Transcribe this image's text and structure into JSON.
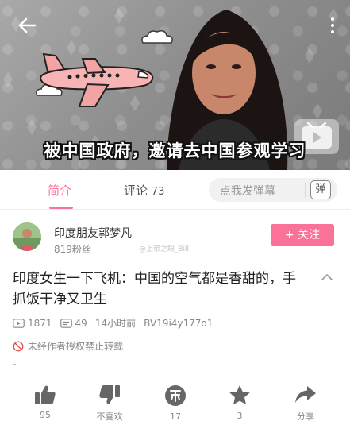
{
  "video": {
    "caption": "被中国政府，邀请去中国参观学习"
  },
  "tabs": {
    "intro_label": "简介",
    "comments_label": "评论",
    "comments_count": "73"
  },
  "danmaku": {
    "placeholder": "点我发弹幕",
    "toggle_label": "弹"
  },
  "uploader": {
    "name": "印度朋友郭梦凡",
    "fans": "819粉丝",
    "watermark": "@上帝之眼_Bill",
    "follow_label": "+ 关注"
  },
  "info": {
    "title": "印度女生一下飞机：中国的空气都是香甜的，手抓饭干净又卫生",
    "views": "1871",
    "danmaku_count": "49",
    "time": "14小时前",
    "bvid": "BV19i4y177o1",
    "copyright_notice": "未经作者授权禁止转载"
  },
  "actions": {
    "like_count": "95",
    "dislike_label": "不喜欢",
    "coin_count": "17",
    "favorite_count": "3",
    "share_label": "分享"
  },
  "colors": {
    "accent": "#fb7299",
    "muted": "#888888"
  },
  "icons": [
    "back-arrow-icon",
    "more-icon",
    "play-badge-icon",
    "plane-icon",
    "expand-icon",
    "view-icon",
    "danmaku-icon",
    "no-reprint-icon",
    "like-icon",
    "dislike-icon",
    "coin-icon",
    "favorite-icon",
    "share-icon"
  ]
}
